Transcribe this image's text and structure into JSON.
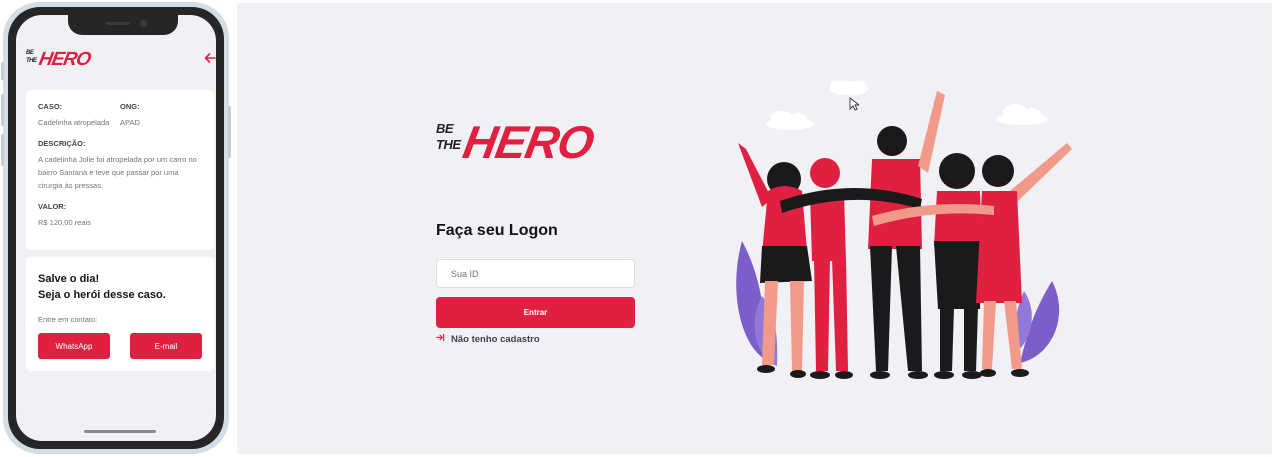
{
  "brand": {
    "be": "BE",
    "the": "THE",
    "hero": "HERO"
  },
  "mobile": {
    "incident": {
      "case_label": "CASO:",
      "case_value": "Cadelinha atropelada",
      "ong_label": "ONG:",
      "ong_value": "APAD",
      "description_label": "DESCRIÇÃO:",
      "description_value": "A cadelinha Jolie foi atropelada por um carro no bairro Santana e teve que passar por uma cirurgia às pressas.",
      "value_label": "VALOR:",
      "value_value": "R$ 120,00 reais"
    },
    "contact": {
      "line1": "Salve o dia!",
      "line2": "Seja o herói desse caso.",
      "prompt": "Entre em contato:",
      "whatsapp": "WhatsApp",
      "email": "E-mail"
    }
  },
  "logon": {
    "title": "Faça seu Logon",
    "id_placeholder": "Sua ID",
    "enter": "Entrar",
    "register": "Não tenho cadastro"
  },
  "colors": {
    "accent": "#e02041",
    "background": "#f0f0f5",
    "text": "#13131a"
  },
  "icons": {
    "back": "arrow-left-icon",
    "register": "log-in-icon"
  }
}
